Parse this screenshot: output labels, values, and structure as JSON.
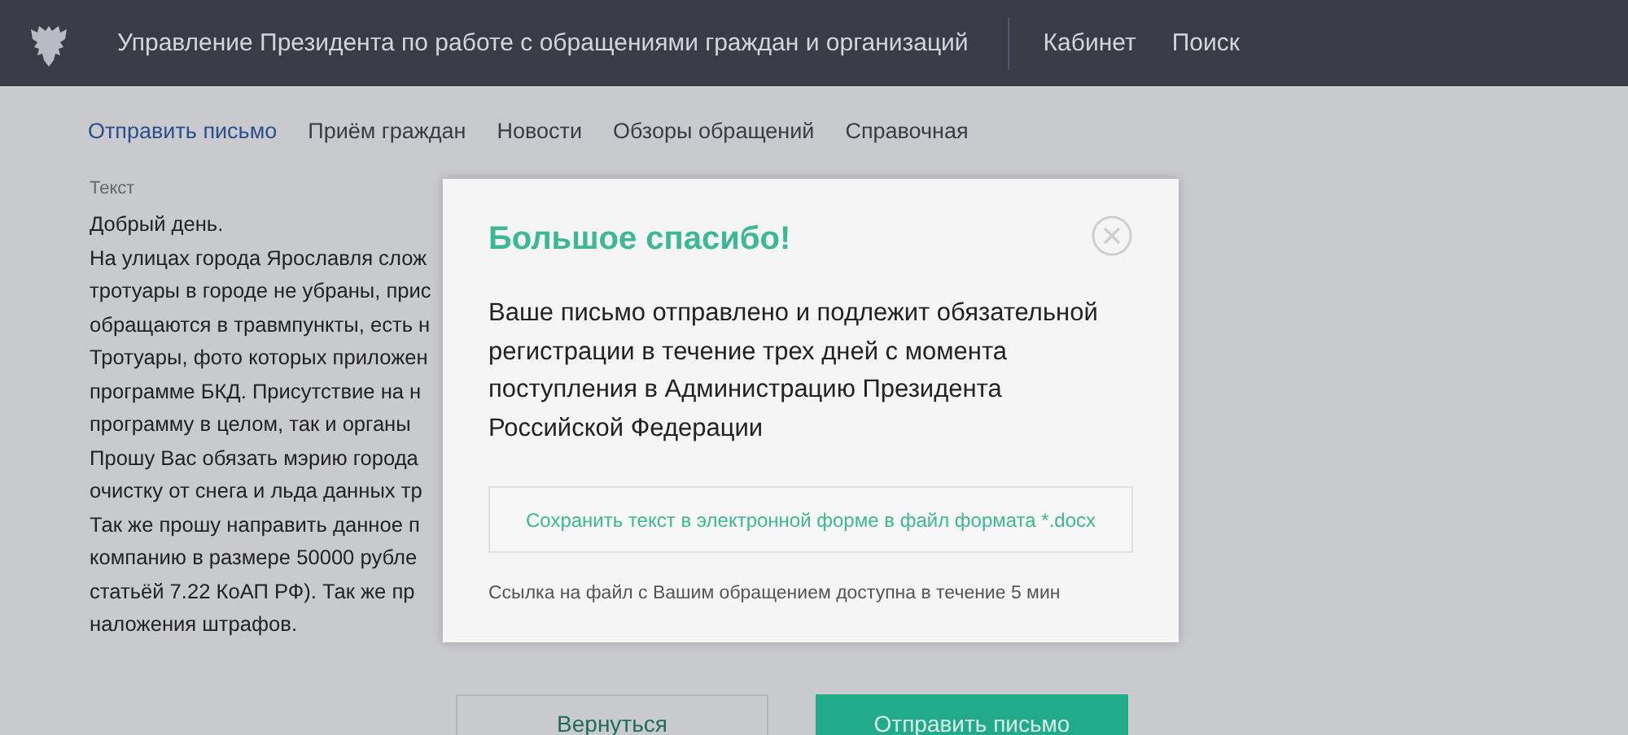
{
  "header": {
    "title": "Управление Президента по работе с обращениями граждан и организаций",
    "links": [
      "Кабинет",
      "Поиск"
    ]
  },
  "nav": [
    {
      "label": "Отправить письмо",
      "selected": true
    },
    {
      "label": "Приём граждан",
      "selected": false
    },
    {
      "label": "Новости",
      "selected": false
    },
    {
      "label": "Обзоры обращений",
      "selected": false
    },
    {
      "label": "Справочная",
      "selected": false
    }
  ],
  "letter": {
    "label": "Текст",
    "lines": [
      "Добрый день.",
      "На улицах города Ярославля слож",
      "тротуары в городе не убраны, прис",
      "обращаются в травмпункты, есть н",
      "Тротуары, фото которых приложен",
      "программе БКД. Присутствие на н",
      "программу в целом, так и органы",
      "Прошу Вас обязать мэрию города",
      "очистку от снега и льда данных тр",
      "Так же прошу направить данное п",
      "компанию в размере 50000 рубле",
      "статьёй 7.22 КоАП РФ). Так же пр",
      "наложения штрафов."
    ]
  },
  "buttons": [
    {
      "label": "Вернуться",
      "kind": "secondary"
    },
    {
      "label": "Отправить письмо",
      "kind": "primary"
    }
  ],
  "dialog": {
    "title": "Большое спасибо!",
    "message": "Ваше письмо отправлено и подлежит обязательной регистрации в течение трех дней с момента поступления в Администрацию Президента Российской Федерации",
    "save_link": "Сохранить текст в электронной форме в файл формата *.docx",
    "note": "Ссылка на файл с Вашим обращением доступна в течение 5 мин"
  }
}
